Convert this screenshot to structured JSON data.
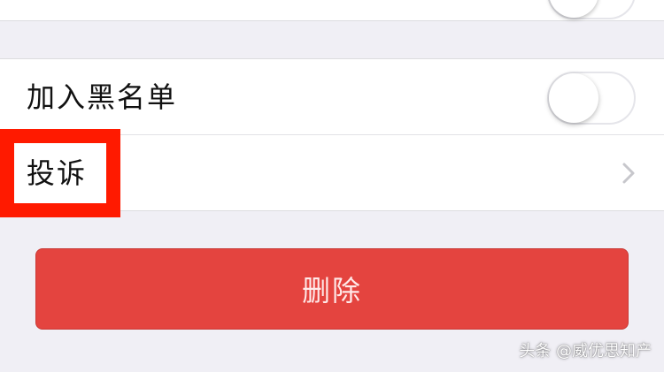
{
  "settings": {
    "blacklist_label": "加入黑名单",
    "blacklist_on": false,
    "report_label": "投诉"
  },
  "delete_button_label": "删除",
  "watermark": "头条 @威优思知产",
  "colors": {
    "highlight": "#ff1a00",
    "delete_button": "#e4443f",
    "background": "#f0eff5"
  }
}
